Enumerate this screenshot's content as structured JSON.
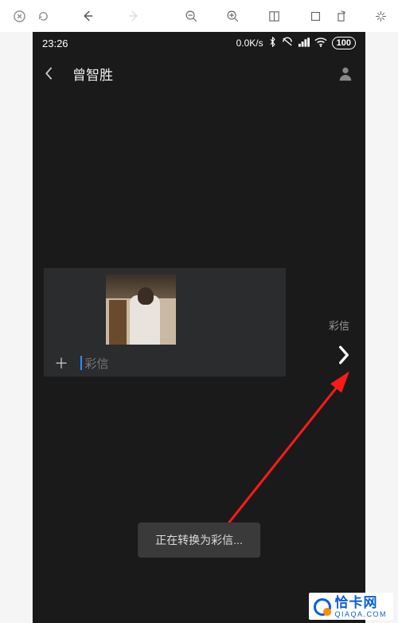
{
  "status": {
    "time": "23:26",
    "net_speed": "0.0K/s",
    "battery": "100"
  },
  "chat": {
    "contact_name": "曾智胜"
  },
  "compose": {
    "placeholder": "彩信",
    "mms_label": "彩信"
  },
  "toast": {
    "text": "正在转换为彩信..."
  },
  "watermark": {
    "cn": "恰卡网",
    "en": "QIAQA.COM"
  }
}
